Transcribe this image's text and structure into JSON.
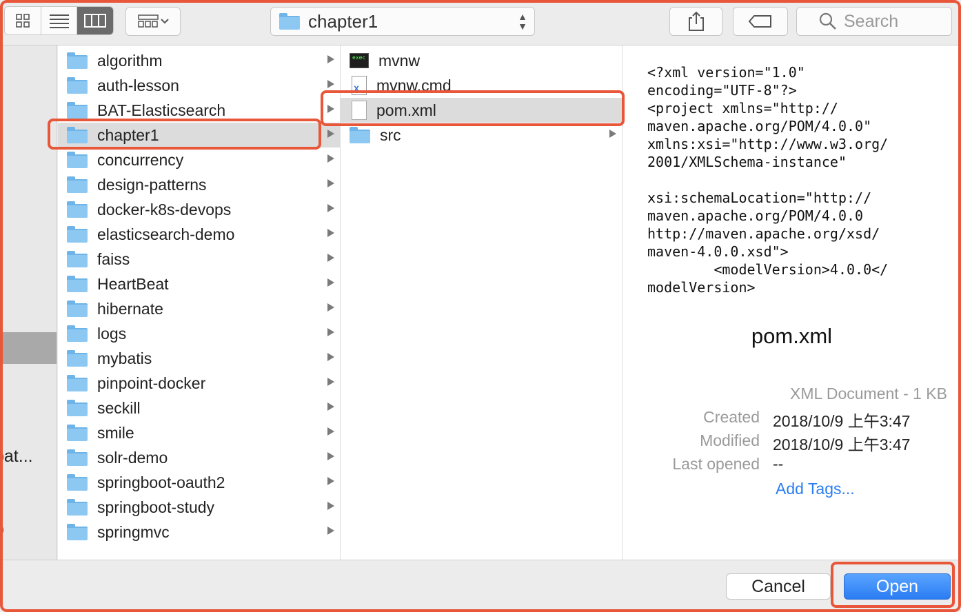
{
  "toolbar": {
    "view_modes": [
      "icon-view",
      "list-view",
      "column-view",
      "gallery-view"
    ],
    "path_popup": "chapter1",
    "search_placeholder": "Search"
  },
  "sidebar": {
    "fragments": [
      "bat...",
      "D"
    ]
  },
  "column1": [
    {
      "name": "algorithm",
      "type": "folder"
    },
    {
      "name": "auth-lesson",
      "type": "folder"
    },
    {
      "name": "BAT-Elasticsearch",
      "type": "folder"
    },
    {
      "name": "chapter1",
      "type": "folder",
      "selected": true
    },
    {
      "name": "concurrency",
      "type": "folder"
    },
    {
      "name": "design-patterns",
      "type": "folder"
    },
    {
      "name": "docker-k8s-devops",
      "type": "folder"
    },
    {
      "name": "elasticsearch-demo",
      "type": "folder"
    },
    {
      "name": "faiss",
      "type": "folder"
    },
    {
      "name": "HeartBeat",
      "type": "folder"
    },
    {
      "name": "hibernate",
      "type": "folder"
    },
    {
      "name": "logs",
      "type": "folder"
    },
    {
      "name": "mybatis",
      "type": "folder"
    },
    {
      "name": "pinpoint-docker",
      "type": "folder"
    },
    {
      "name": "seckill",
      "type": "folder"
    },
    {
      "name": "smile",
      "type": "folder"
    },
    {
      "name": "solr-demo",
      "type": "folder"
    },
    {
      "name": "springboot-oauth2",
      "type": "folder"
    },
    {
      "name": "springboot-study",
      "type": "folder"
    },
    {
      "name": "springmvc",
      "type": "folder"
    }
  ],
  "column2": [
    {
      "name": "mvnw",
      "type": "exec"
    },
    {
      "name": "mvnw.cmd",
      "type": "cmd"
    },
    {
      "name": "pom.xml",
      "type": "file",
      "selected": true
    },
    {
      "name": "src",
      "type": "folder"
    }
  ],
  "preview": {
    "code": "<?xml version=\"1.0\"\nencoding=\"UTF-8\"?>\n<project xmlns=\"http://\nmaven.apache.org/POM/4.0.0\"\nxmlns:xsi=\"http://www.w3.org/\n2001/XMLSchema-instance\"\n\nxsi:schemaLocation=\"http://\nmaven.apache.org/POM/4.0.0\nhttp://maven.apache.org/xsd/\nmaven-4.0.0.xsd\">\n        <modelVersion>4.0.0</\nmodelVersion>",
    "filename": "pom.xml",
    "kind": "XML Document - 1 KB",
    "created_label": "Created",
    "created_value": "2018/10/9 上午3:47",
    "modified_label": "Modified",
    "modified_value": "2018/10/9 上午3:47",
    "last_opened_label": "Last opened",
    "last_opened_value": "--",
    "add_tags": "Add Tags..."
  },
  "footer": {
    "cancel_label": "Cancel",
    "open_label": "Open"
  },
  "colors": {
    "selection_blue": "#2e6bd6",
    "highlight": "#e8573a",
    "open_button": "#2a7cf3",
    "link": "#2a7cf3"
  }
}
